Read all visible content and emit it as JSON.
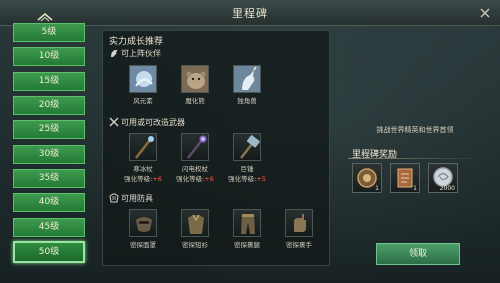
{
  "window": {
    "title": "里程碑"
  },
  "levels": [
    {
      "label": "5级",
      "active": false
    },
    {
      "label": "10级",
      "active": false
    },
    {
      "label": "15级",
      "active": false
    },
    {
      "label": "20级",
      "active": false
    },
    {
      "label": "25级",
      "active": false
    },
    {
      "label": "30级",
      "active": false
    },
    {
      "label": "35级",
      "active": false
    },
    {
      "label": "40级",
      "active": false
    },
    {
      "label": "45级",
      "active": false
    },
    {
      "label": "50级",
      "active": true
    }
  ],
  "recommend": {
    "heading": "实力成长推荐",
    "companions": {
      "title": "可上阵伙伴",
      "items": [
        {
          "name": "风元素",
          "icon": "wind-elemental-icon"
        },
        {
          "name": "魔化熊",
          "icon": "demon-bear-icon"
        },
        {
          "name": "独角兽",
          "icon": "unicorn-icon"
        }
      ]
    },
    "weapons": {
      "title": "可用或可改造武器",
      "items": [
        {
          "name": "寒冰杖",
          "stat_label": "强化等级:",
          "stat_value": "+6",
          "icon": "ice-staff-icon"
        },
        {
          "name": "闪电权杖",
          "stat_label": "强化等级:",
          "stat_value": "+6",
          "icon": "lightning-scepter-icon"
        },
        {
          "name": "巨锤",
          "stat_label": "强化等级:",
          "stat_value": "+5",
          "icon": "giant-hammer-icon"
        }
      ]
    },
    "armor": {
      "title": "可用防具",
      "items": [
        {
          "name": "密探面罩",
          "icon": "spy-mask-icon"
        },
        {
          "name": "密探短衫",
          "icon": "spy-tunic-icon"
        },
        {
          "name": "密探裹腿",
          "icon": "spy-leggings-icon"
        },
        {
          "name": "密探裹手",
          "icon": "spy-gloves-icon"
        }
      ]
    }
  },
  "right": {
    "description": "挑战世界精英和世界首领",
    "reward_title": "里程碑奖励",
    "rewards": [
      {
        "icon": "medal-icon",
        "count": "1"
      },
      {
        "icon": "scroll-book-icon",
        "count": "1"
      },
      {
        "icon": "silver-coin-icon",
        "count": "2000"
      }
    ],
    "claim_label": "领取"
  },
  "colors": {
    "level_green": "#2f8c40",
    "enhance_red": "#ff5a4a",
    "claim_green": "#3f8a5a"
  }
}
